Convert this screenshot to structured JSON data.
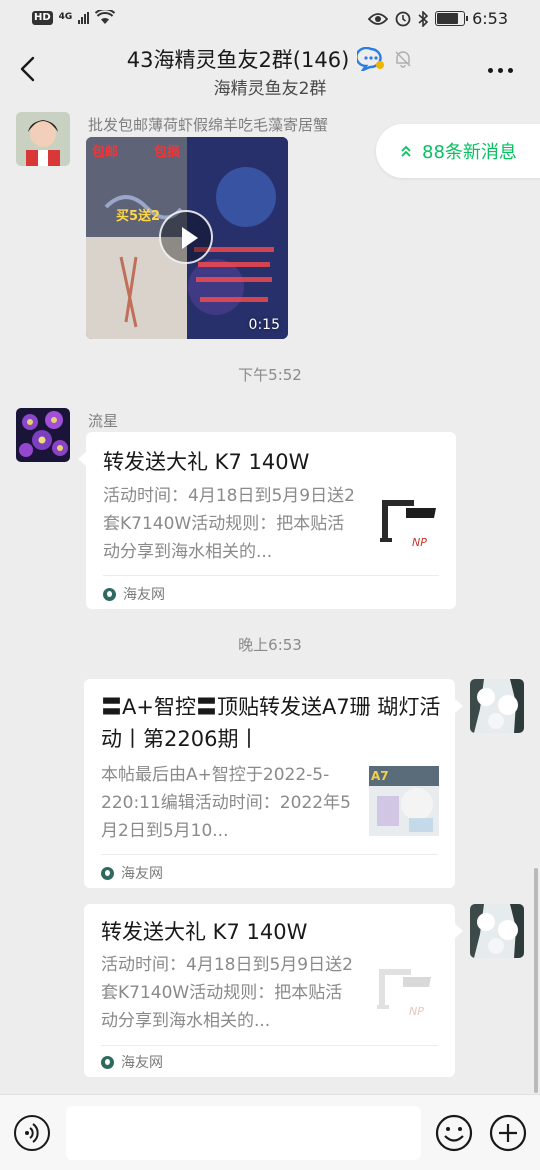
{
  "status_bar": {
    "hd": "HD",
    "network": "4G",
    "time": "6:53"
  },
  "header": {
    "title": "43海精灵鱼友2群(146)",
    "subtitle": "海精灵鱼友2群"
  },
  "new_messages": {
    "label": "88条新消息"
  },
  "messages": [
    {
      "sender": "批发包邮薄荷虾假绵羊吃毛藻寄居蟹",
      "type": "video",
      "duration": "0:15",
      "overlay_texts": [
        "包邮",
        "包损",
        "买5送2"
      ]
    },
    {
      "type": "timestamp",
      "text": "下午5:52"
    },
    {
      "sender": "流星",
      "type": "link",
      "title": "转发送大礼 K7 140W",
      "description": "活动时间：4月18日到5月9日送2套K7140W活动规则：把本贴活动分享到海水相关的...",
      "source": "海友网"
    },
    {
      "type": "timestamp",
      "text": "晚上6:53"
    },
    {
      "type": "link",
      "title": "〓A+智控〓顶贴转发送A7珊 瑚灯活动丨第2206期丨",
      "description": "本帖最后由A+智控于2022-5-220:11编辑活动时间：2022年5月2日到5月10...",
      "source": "海友网"
    },
    {
      "type": "link",
      "title": "转发送大礼 K7 140W",
      "description": "活动时间：4月18日到5月9日送2套K7140W活动规则：把本贴活动分享到海水相关的...",
      "source": "海友网"
    }
  ],
  "input": {
    "value": ""
  },
  "colors": {
    "background": "#ededed",
    "accent": "#07c160",
    "bubble": "#ffffff"
  }
}
